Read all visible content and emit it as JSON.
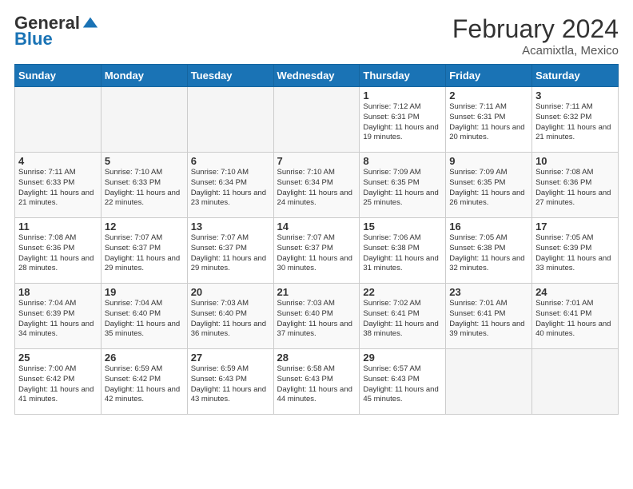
{
  "logo": {
    "general": "General",
    "blue": "Blue"
  },
  "title": "February 2024",
  "location": "Acamixtla, Mexico",
  "days_header": [
    "Sunday",
    "Monday",
    "Tuesday",
    "Wednesday",
    "Thursday",
    "Friday",
    "Saturday"
  ],
  "weeks": [
    [
      {
        "day": "",
        "info": ""
      },
      {
        "day": "",
        "info": ""
      },
      {
        "day": "",
        "info": ""
      },
      {
        "day": "",
        "info": ""
      },
      {
        "day": "1",
        "info": "Sunrise: 7:12 AM\nSunset: 6:31 PM\nDaylight: 11 hours and 19 minutes."
      },
      {
        "day": "2",
        "info": "Sunrise: 7:11 AM\nSunset: 6:31 PM\nDaylight: 11 hours and 20 minutes."
      },
      {
        "day": "3",
        "info": "Sunrise: 7:11 AM\nSunset: 6:32 PM\nDaylight: 11 hours and 21 minutes."
      }
    ],
    [
      {
        "day": "4",
        "info": "Sunrise: 7:11 AM\nSunset: 6:33 PM\nDaylight: 11 hours and 21 minutes."
      },
      {
        "day": "5",
        "info": "Sunrise: 7:10 AM\nSunset: 6:33 PM\nDaylight: 11 hours and 22 minutes."
      },
      {
        "day": "6",
        "info": "Sunrise: 7:10 AM\nSunset: 6:34 PM\nDaylight: 11 hours and 23 minutes."
      },
      {
        "day": "7",
        "info": "Sunrise: 7:10 AM\nSunset: 6:34 PM\nDaylight: 11 hours and 24 minutes."
      },
      {
        "day": "8",
        "info": "Sunrise: 7:09 AM\nSunset: 6:35 PM\nDaylight: 11 hours and 25 minutes."
      },
      {
        "day": "9",
        "info": "Sunrise: 7:09 AM\nSunset: 6:35 PM\nDaylight: 11 hours and 26 minutes."
      },
      {
        "day": "10",
        "info": "Sunrise: 7:08 AM\nSunset: 6:36 PM\nDaylight: 11 hours and 27 minutes."
      }
    ],
    [
      {
        "day": "11",
        "info": "Sunrise: 7:08 AM\nSunset: 6:36 PM\nDaylight: 11 hours and 28 minutes."
      },
      {
        "day": "12",
        "info": "Sunrise: 7:07 AM\nSunset: 6:37 PM\nDaylight: 11 hours and 29 minutes."
      },
      {
        "day": "13",
        "info": "Sunrise: 7:07 AM\nSunset: 6:37 PM\nDaylight: 11 hours and 29 minutes."
      },
      {
        "day": "14",
        "info": "Sunrise: 7:07 AM\nSunset: 6:37 PM\nDaylight: 11 hours and 30 minutes."
      },
      {
        "day": "15",
        "info": "Sunrise: 7:06 AM\nSunset: 6:38 PM\nDaylight: 11 hours and 31 minutes."
      },
      {
        "day": "16",
        "info": "Sunrise: 7:05 AM\nSunset: 6:38 PM\nDaylight: 11 hours and 32 minutes."
      },
      {
        "day": "17",
        "info": "Sunrise: 7:05 AM\nSunset: 6:39 PM\nDaylight: 11 hours and 33 minutes."
      }
    ],
    [
      {
        "day": "18",
        "info": "Sunrise: 7:04 AM\nSunset: 6:39 PM\nDaylight: 11 hours and 34 minutes."
      },
      {
        "day": "19",
        "info": "Sunrise: 7:04 AM\nSunset: 6:40 PM\nDaylight: 11 hours and 35 minutes."
      },
      {
        "day": "20",
        "info": "Sunrise: 7:03 AM\nSunset: 6:40 PM\nDaylight: 11 hours and 36 minutes."
      },
      {
        "day": "21",
        "info": "Sunrise: 7:03 AM\nSunset: 6:40 PM\nDaylight: 11 hours and 37 minutes."
      },
      {
        "day": "22",
        "info": "Sunrise: 7:02 AM\nSunset: 6:41 PM\nDaylight: 11 hours and 38 minutes."
      },
      {
        "day": "23",
        "info": "Sunrise: 7:01 AM\nSunset: 6:41 PM\nDaylight: 11 hours and 39 minutes."
      },
      {
        "day": "24",
        "info": "Sunrise: 7:01 AM\nSunset: 6:41 PM\nDaylight: 11 hours and 40 minutes."
      }
    ],
    [
      {
        "day": "25",
        "info": "Sunrise: 7:00 AM\nSunset: 6:42 PM\nDaylight: 11 hours and 41 minutes."
      },
      {
        "day": "26",
        "info": "Sunrise: 6:59 AM\nSunset: 6:42 PM\nDaylight: 11 hours and 42 minutes."
      },
      {
        "day": "27",
        "info": "Sunrise: 6:59 AM\nSunset: 6:43 PM\nDaylight: 11 hours and 43 minutes."
      },
      {
        "day": "28",
        "info": "Sunrise: 6:58 AM\nSunset: 6:43 PM\nDaylight: 11 hours and 44 minutes."
      },
      {
        "day": "29",
        "info": "Sunrise: 6:57 AM\nSunset: 6:43 PM\nDaylight: 11 hours and 45 minutes."
      },
      {
        "day": "",
        "info": ""
      },
      {
        "day": "",
        "info": ""
      }
    ]
  ]
}
